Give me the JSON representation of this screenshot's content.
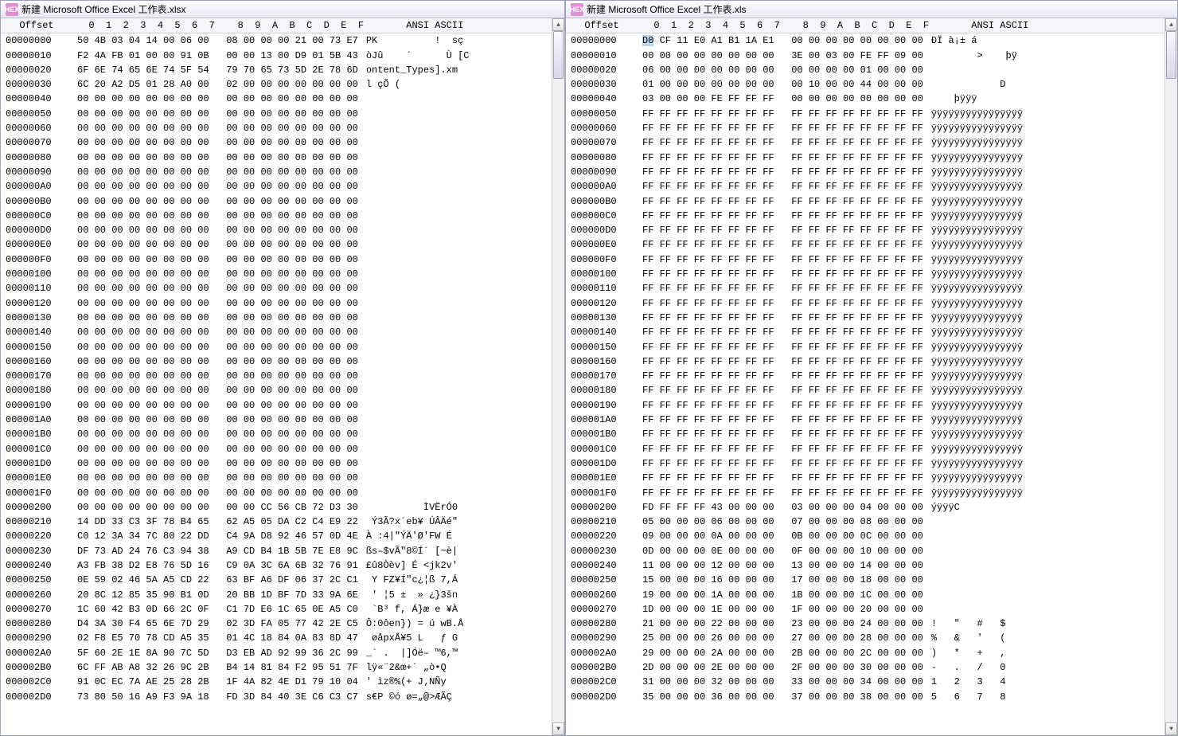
{
  "left": {
    "title": "新建 Microsoft Office Excel 工作表.xlsx",
    "header": {
      "offset": "Offset",
      "hex": "  0  1  2  3  4  5  6  7    8  9  A  B  C  D  E  F",
      "ascii": "      ANSI ASCII    "
    },
    "rows": [
      {
        "o": "00000000",
        "h": "50 4B 03 04 14 00 06 00   08 00 00 00 21 00 73 E7",
        "a": "PK          !  sç"
      },
      {
        "o": "00000010",
        "h": "F2 4A FB 01 00 00 91 0B   00 00 13 00 D9 01 5B 43",
        "a": "òJû    ´      Ù [C"
      },
      {
        "o": "00000020",
        "h": "6F 6E 74 65 6E 74 5F 54   79 70 65 73 5D 2E 78 6D",
        "a": "ontent_Types].xm"
      },
      {
        "o": "00000030",
        "h": "6C 20 A2 D5 01 28 A0 00   02 00 00 00 00 00 00 00",
        "a": "l çÕ (           "
      },
      {
        "o": "00000040",
        "h": "00 00 00 00 00 00 00 00   00 00 00 00 00 00 00 00",
        "a": "                "
      },
      {
        "o": "00000050",
        "h": "00 00 00 00 00 00 00 00   00 00 00 00 00 00 00 00",
        "a": "                "
      },
      {
        "o": "00000060",
        "h": "00 00 00 00 00 00 00 00   00 00 00 00 00 00 00 00",
        "a": "                "
      },
      {
        "o": "00000070",
        "h": "00 00 00 00 00 00 00 00   00 00 00 00 00 00 00 00",
        "a": "                "
      },
      {
        "o": "00000080",
        "h": "00 00 00 00 00 00 00 00   00 00 00 00 00 00 00 00",
        "a": "                "
      },
      {
        "o": "00000090",
        "h": "00 00 00 00 00 00 00 00   00 00 00 00 00 00 00 00",
        "a": "                "
      },
      {
        "o": "000000A0",
        "h": "00 00 00 00 00 00 00 00   00 00 00 00 00 00 00 00",
        "a": "                "
      },
      {
        "o": "000000B0",
        "h": "00 00 00 00 00 00 00 00   00 00 00 00 00 00 00 00",
        "a": "                "
      },
      {
        "o": "000000C0",
        "h": "00 00 00 00 00 00 00 00   00 00 00 00 00 00 00 00",
        "a": "                "
      },
      {
        "o": "000000D0",
        "h": "00 00 00 00 00 00 00 00   00 00 00 00 00 00 00 00",
        "a": "                "
      },
      {
        "o": "000000E0",
        "h": "00 00 00 00 00 00 00 00   00 00 00 00 00 00 00 00",
        "a": "                "
      },
      {
        "o": "000000F0",
        "h": "00 00 00 00 00 00 00 00   00 00 00 00 00 00 00 00",
        "a": "                "
      },
      {
        "o": "00000100",
        "h": "00 00 00 00 00 00 00 00   00 00 00 00 00 00 00 00",
        "a": "                "
      },
      {
        "o": "00000110",
        "h": "00 00 00 00 00 00 00 00   00 00 00 00 00 00 00 00",
        "a": "                "
      },
      {
        "o": "00000120",
        "h": "00 00 00 00 00 00 00 00   00 00 00 00 00 00 00 00",
        "a": "                "
      },
      {
        "o": "00000130",
        "h": "00 00 00 00 00 00 00 00   00 00 00 00 00 00 00 00",
        "a": "                "
      },
      {
        "o": "00000140",
        "h": "00 00 00 00 00 00 00 00   00 00 00 00 00 00 00 00",
        "a": "                "
      },
      {
        "o": "00000150",
        "h": "00 00 00 00 00 00 00 00   00 00 00 00 00 00 00 00",
        "a": "                "
      },
      {
        "o": "00000160",
        "h": "00 00 00 00 00 00 00 00   00 00 00 00 00 00 00 00",
        "a": "                "
      },
      {
        "o": "00000170",
        "h": "00 00 00 00 00 00 00 00   00 00 00 00 00 00 00 00",
        "a": "                "
      },
      {
        "o": "00000180",
        "h": "00 00 00 00 00 00 00 00   00 00 00 00 00 00 00 00",
        "a": "                "
      },
      {
        "o": "00000190",
        "h": "00 00 00 00 00 00 00 00   00 00 00 00 00 00 00 00",
        "a": "                "
      },
      {
        "o": "000001A0",
        "h": "00 00 00 00 00 00 00 00   00 00 00 00 00 00 00 00",
        "a": "                "
      },
      {
        "o": "000001B0",
        "h": "00 00 00 00 00 00 00 00   00 00 00 00 00 00 00 00",
        "a": "                "
      },
      {
        "o": "000001C0",
        "h": "00 00 00 00 00 00 00 00   00 00 00 00 00 00 00 00",
        "a": "                "
      },
      {
        "o": "000001D0",
        "h": "00 00 00 00 00 00 00 00   00 00 00 00 00 00 00 00",
        "a": "                "
      },
      {
        "o": "000001E0",
        "h": "00 00 00 00 00 00 00 00   00 00 00 00 00 00 00 00",
        "a": "                "
      },
      {
        "o": "000001F0",
        "h": "00 00 00 00 00 00 00 00   00 00 00 00 00 00 00 00",
        "a": "                "
      },
      {
        "o": "00000200",
        "h": "00 00 00 00 00 00 00 00   00 00 CC 56 CB 72 D3 30",
        "a": "          ÌVËrÓ0"
      },
      {
        "o": "00000210",
        "h": "14 DD 33 C3 3F 78 B4 65   62 A5 05 DA C2 C4 E9 22",
        "a": " Ý3Ã?x´eb¥ ÚÂÄé\""
      },
      {
        "o": "00000220",
        "h": "C0 12 3A 34 7C 80 22 DD   C4 9A D8 92 46 57 0D 4E",
        "a": "À :4|\"ÝÄ'Ø'FW É"
      },
      {
        "o": "00000230",
        "h": "DF 73 AD 24 76 C3 94 38   A9 CD B4 1B 5B 7E E8 9C",
        "a": "ßs–$vÃ\"8©Í´ [~è|"
      },
      {
        "o": "00000240",
        "h": "A3 FB 38 D2 E8 76 5D 16   C9 0A 3C 6A 6B 32 76 91",
        "a": "£û8Òèv] É <jk2v'"
      },
      {
        "o": "00000250",
        "h": "0E 59 02 46 5A A5 CD 22   63 BF A6 DF 06 37 2C C1",
        "a": " Y FZ¥Í\"c¿¦ß 7,Á"
      },
      {
        "o": "00000260",
        "h": "20 8C 12 85 35 90 B1 0D   20 BB 1D BF 7D 33 9A 6E",
        "a": " ' ¦5 ±  » ¿}3šn"
      },
      {
        "o": "00000270",
        "h": "1C 60 42 B3 0D 66 2C 0F   C1 7D E6 1C 65 0E A5 C0",
        "a": " `B³ f, Á}æ e ¥À"
      },
      {
        "o": "00000280",
        "h": "D4 3A 30 F4 65 6E 7D 29   02 3D FA 05 77 42 2E C5",
        "a": "Ô:0ôen}) = ú wB.Å"
      },
      {
        "o": "00000290",
        "h": "02 F8 E5 70 78 CD A5 35   01 4C 18 84 0A 83 8D 47",
        "a": " øåpxÅ¥5 L   ƒ G"
      },
      {
        "o": "000002A0",
        "h": "5F 60 2E 1E 8A 90 7C 5D   D3 EB AD 92 99 36 2C 99",
        "a": "_` .  |]Óë– ™6,™"
      },
      {
        "o": "000002B0",
        "h": "6C FF AB A8 32 26 9C 2B   B4 14 81 84 F2 95 51 7F",
        "a": "lÿ«¨2&œ+´ „ò•Q"
      },
      {
        "o": "000002C0",
        "h": "91 0C EC 7A AE 25 28 2B   1F 4A 82 4E D1 79 10 04",
        "a": "' ìz®%(+ J‚NÑy  "
      },
      {
        "o": "000002D0",
        "h": "73 80 50 16 A9 F3 9A 18   FD 3D 84 40 3E C6 C3 C7",
        "a": "s€P ©ó ø=„@>ÆÃÇ"
      }
    ]
  },
  "right": {
    "title": "新建 Microsoft Office Excel 工作表.xls",
    "header": {
      "offset": "Offset",
      "hex": "  0  1  2  3  4  5  6  7    8  9  A  B  C  D  E  F",
      "ascii": "      ANSI ASCII    "
    },
    "rows": [
      {
        "o": "00000000",
        "h": "D0 CF 11 E0 A1 B1 1A E1   00 00 00 00 00 00 00 00",
        "a": "ÐÏ à¡± á         "
      },
      {
        "o": "00000010",
        "h": "00 00 00 00 00 00 00 00   3E 00 03 00 FE FF 09 00",
        "a": "        >    þÿ  "
      },
      {
        "o": "00000020",
        "h": "06 00 00 00 00 00 00 00   00 00 00 00 01 00 00 00",
        "a": "                "
      },
      {
        "o": "00000030",
        "h": "01 00 00 00 00 00 00 00   00 10 00 00 44 00 00 00",
        "a": "            D   "
      },
      {
        "o": "00000040",
        "h": "03 00 00 00 FE FF FF FF   00 00 00 00 00 00 00 00",
        "a": "    þÿÿÿ        "
      },
      {
        "o": "00000050",
        "h": "FF FF FF FF FF FF FF FF   FF FF FF FF FF FF FF FF",
        "a": "ÿÿÿÿÿÿÿÿÿÿÿÿÿÿÿÿ"
      },
      {
        "o": "00000060",
        "h": "FF FF FF FF FF FF FF FF   FF FF FF FF FF FF FF FF",
        "a": "ÿÿÿÿÿÿÿÿÿÿÿÿÿÿÿÿ"
      },
      {
        "o": "00000070",
        "h": "FF FF FF FF FF FF FF FF   FF FF FF FF FF FF FF FF",
        "a": "ÿÿÿÿÿÿÿÿÿÿÿÿÿÿÿÿ"
      },
      {
        "o": "00000080",
        "h": "FF FF FF FF FF FF FF FF   FF FF FF FF FF FF FF FF",
        "a": "ÿÿÿÿÿÿÿÿÿÿÿÿÿÿÿÿ"
      },
      {
        "o": "00000090",
        "h": "FF FF FF FF FF FF FF FF   FF FF FF FF FF FF FF FF",
        "a": "ÿÿÿÿÿÿÿÿÿÿÿÿÿÿÿÿ"
      },
      {
        "o": "000000A0",
        "h": "FF FF FF FF FF FF FF FF   FF FF FF FF FF FF FF FF",
        "a": "ÿÿÿÿÿÿÿÿÿÿÿÿÿÿÿÿ"
      },
      {
        "o": "000000B0",
        "h": "FF FF FF FF FF FF FF FF   FF FF FF FF FF FF FF FF",
        "a": "ÿÿÿÿÿÿÿÿÿÿÿÿÿÿÿÿ"
      },
      {
        "o": "000000C0",
        "h": "FF FF FF FF FF FF FF FF   FF FF FF FF FF FF FF FF",
        "a": "ÿÿÿÿÿÿÿÿÿÿÿÿÿÿÿÿ"
      },
      {
        "o": "000000D0",
        "h": "FF FF FF FF FF FF FF FF   FF FF FF FF FF FF FF FF",
        "a": "ÿÿÿÿÿÿÿÿÿÿÿÿÿÿÿÿ"
      },
      {
        "o": "000000E0",
        "h": "FF FF FF FF FF FF FF FF   FF FF FF FF FF FF FF FF",
        "a": "ÿÿÿÿÿÿÿÿÿÿÿÿÿÿÿÿ"
      },
      {
        "o": "000000F0",
        "h": "FF FF FF FF FF FF FF FF   FF FF FF FF FF FF FF FF",
        "a": "ÿÿÿÿÿÿÿÿÿÿÿÿÿÿÿÿ"
      },
      {
        "o": "00000100",
        "h": "FF FF FF FF FF FF FF FF   FF FF FF FF FF FF FF FF",
        "a": "ÿÿÿÿÿÿÿÿÿÿÿÿÿÿÿÿ"
      },
      {
        "o": "00000110",
        "h": "FF FF FF FF FF FF FF FF   FF FF FF FF FF FF FF FF",
        "a": "ÿÿÿÿÿÿÿÿÿÿÿÿÿÿÿÿ"
      },
      {
        "o": "00000120",
        "h": "FF FF FF FF FF FF FF FF   FF FF FF FF FF FF FF FF",
        "a": "ÿÿÿÿÿÿÿÿÿÿÿÿÿÿÿÿ"
      },
      {
        "o": "00000130",
        "h": "FF FF FF FF FF FF FF FF   FF FF FF FF FF FF FF FF",
        "a": "ÿÿÿÿÿÿÿÿÿÿÿÿÿÿÿÿ"
      },
      {
        "o": "00000140",
        "h": "FF FF FF FF FF FF FF FF   FF FF FF FF FF FF FF FF",
        "a": "ÿÿÿÿÿÿÿÿÿÿÿÿÿÿÿÿ"
      },
      {
        "o": "00000150",
        "h": "FF FF FF FF FF FF FF FF   FF FF FF FF FF FF FF FF",
        "a": "ÿÿÿÿÿÿÿÿÿÿÿÿÿÿÿÿ"
      },
      {
        "o": "00000160",
        "h": "FF FF FF FF FF FF FF FF   FF FF FF FF FF FF FF FF",
        "a": "ÿÿÿÿÿÿÿÿÿÿÿÿÿÿÿÿ"
      },
      {
        "o": "00000170",
        "h": "FF FF FF FF FF FF FF FF   FF FF FF FF FF FF FF FF",
        "a": "ÿÿÿÿÿÿÿÿÿÿÿÿÿÿÿÿ"
      },
      {
        "o": "00000180",
        "h": "FF FF FF FF FF FF FF FF   FF FF FF FF FF FF FF FF",
        "a": "ÿÿÿÿÿÿÿÿÿÿÿÿÿÿÿÿ"
      },
      {
        "o": "00000190",
        "h": "FF FF FF FF FF FF FF FF   FF FF FF FF FF FF FF FF",
        "a": "ÿÿÿÿÿÿÿÿÿÿÿÿÿÿÿÿ"
      },
      {
        "o": "000001A0",
        "h": "FF FF FF FF FF FF FF FF   FF FF FF FF FF FF FF FF",
        "a": "ÿÿÿÿÿÿÿÿÿÿÿÿÿÿÿÿ"
      },
      {
        "o": "000001B0",
        "h": "FF FF FF FF FF FF FF FF   FF FF FF FF FF FF FF FF",
        "a": "ÿÿÿÿÿÿÿÿÿÿÿÿÿÿÿÿ"
      },
      {
        "o": "000001C0",
        "h": "FF FF FF FF FF FF FF FF   FF FF FF FF FF FF FF FF",
        "a": "ÿÿÿÿÿÿÿÿÿÿÿÿÿÿÿÿ"
      },
      {
        "o": "000001D0",
        "h": "FF FF FF FF FF FF FF FF   FF FF FF FF FF FF FF FF",
        "a": "ÿÿÿÿÿÿÿÿÿÿÿÿÿÿÿÿ"
      },
      {
        "o": "000001E0",
        "h": "FF FF FF FF FF FF FF FF   FF FF FF FF FF FF FF FF",
        "a": "ÿÿÿÿÿÿÿÿÿÿÿÿÿÿÿÿ"
      },
      {
        "o": "000001F0",
        "h": "FF FF FF FF FF FF FF FF   FF FF FF FF FF FF FF FF",
        "a": "ÿÿÿÿÿÿÿÿÿÿÿÿÿÿÿÿ"
      },
      {
        "o": "00000200",
        "h": "FD FF FF FF 43 00 00 00   03 00 00 00 04 00 00 00",
        "a": "ýÿÿÿC           "
      },
      {
        "o": "00000210",
        "h": "05 00 00 00 06 00 00 00   07 00 00 00 08 00 00 00",
        "a": "                "
      },
      {
        "o": "00000220",
        "h": "09 00 00 00 0A 00 00 00   0B 00 00 00 0C 00 00 00",
        "a": "                "
      },
      {
        "o": "00000230",
        "h": "0D 00 00 00 0E 00 00 00   0F 00 00 00 10 00 00 00",
        "a": "                "
      },
      {
        "o": "00000240",
        "h": "11 00 00 00 12 00 00 00   13 00 00 00 14 00 00 00",
        "a": "                "
      },
      {
        "o": "00000250",
        "h": "15 00 00 00 16 00 00 00   17 00 00 00 18 00 00 00",
        "a": "                "
      },
      {
        "o": "00000260",
        "h": "19 00 00 00 1A 00 00 00   1B 00 00 00 1C 00 00 00",
        "a": "                "
      },
      {
        "o": "00000270",
        "h": "1D 00 00 00 1E 00 00 00   1F 00 00 00 20 00 00 00",
        "a": "                "
      },
      {
        "o": "00000280",
        "h": "21 00 00 00 22 00 00 00   23 00 00 00 24 00 00 00",
        "a": "!   \"   #   $   "
      },
      {
        "o": "00000290",
        "h": "25 00 00 00 26 00 00 00   27 00 00 00 28 00 00 00",
        "a": "%   &   '   (   "
      },
      {
        "o": "000002A0",
        "h": "29 00 00 00 2A 00 00 00   2B 00 00 00 2C 00 00 00",
        "a": ")   *   +   ,   "
      },
      {
        "o": "000002B0",
        "h": "2D 00 00 00 2E 00 00 00   2F 00 00 00 30 00 00 00",
        "a": "-   .   /   0   "
      },
      {
        "o": "000002C0",
        "h": "31 00 00 00 32 00 00 00   33 00 00 00 34 00 00 00",
        "a": "1   2   3   4   "
      },
      {
        "o": "000002D0",
        "h": "35 00 00 00 36 00 00 00   37 00 00 00 38 00 00 00",
        "a": "5   6   7   8   "
      }
    ]
  }
}
